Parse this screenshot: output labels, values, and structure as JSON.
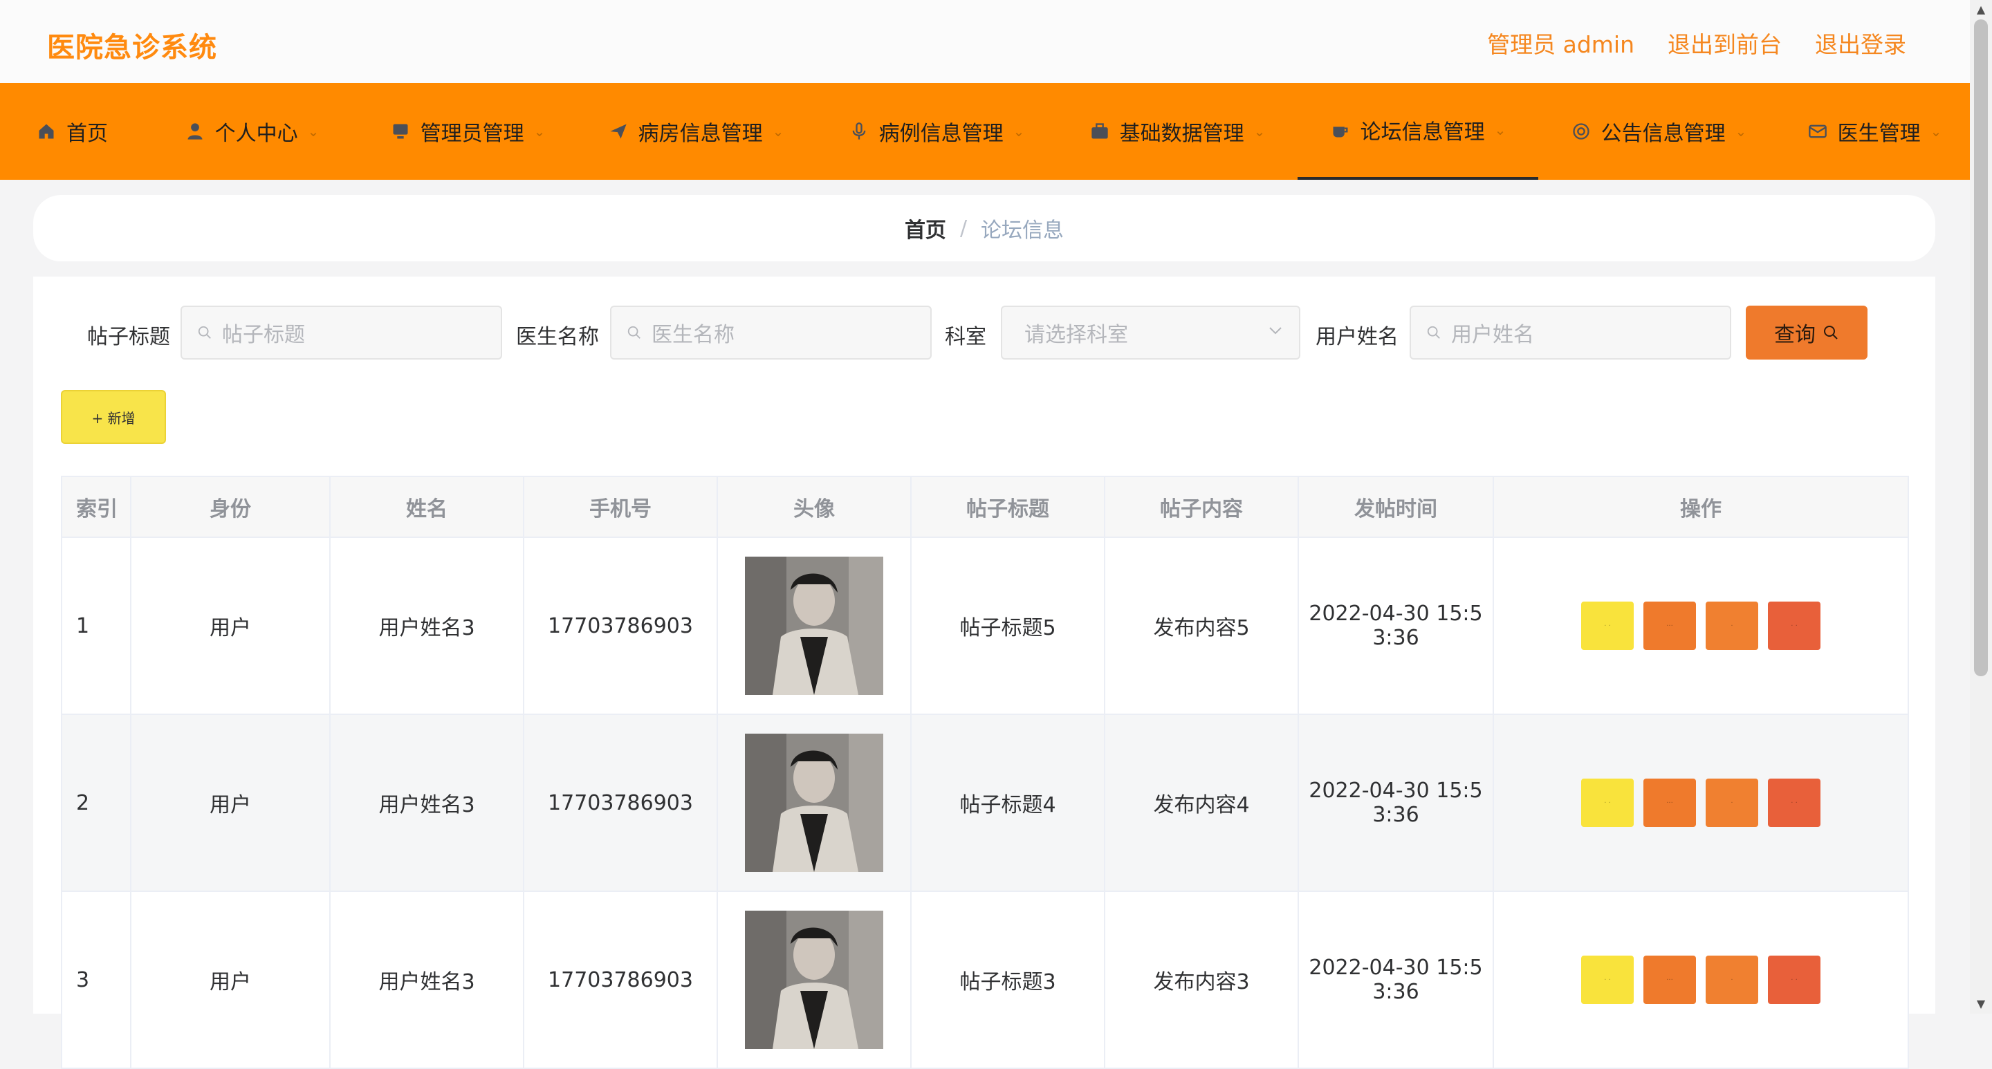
{
  "header": {
    "app_title": "医院急诊系统",
    "admin_label": "管理员 admin",
    "exit_front": "退出到前台",
    "logout": "退出登录"
  },
  "nav": {
    "items": [
      {
        "label": "首页",
        "icon": "home-icon",
        "dropdown": false
      },
      {
        "label": "个人中心",
        "icon": "user-icon",
        "dropdown": true
      },
      {
        "label": "管理员管理",
        "icon": "monitor-icon",
        "dropdown": true
      },
      {
        "label": "病房信息管理",
        "icon": "send-icon",
        "dropdown": true
      },
      {
        "label": "病例信息管理",
        "icon": "microphone-icon",
        "dropdown": true
      },
      {
        "label": "基础数据管理",
        "icon": "briefcase-icon",
        "dropdown": true
      },
      {
        "label": "论坛信息管理",
        "icon": "cup-icon",
        "dropdown": true,
        "active": true
      },
      {
        "label": "公告信息管理",
        "icon": "at-icon",
        "dropdown": true
      },
      {
        "label": "医生管理",
        "icon": "mail-icon",
        "dropdown": true
      }
    ]
  },
  "breadcrumb": {
    "home": "首页",
    "separator": "/",
    "current": "论坛信息"
  },
  "search": {
    "title_label": "帖子标题",
    "title_placeholder": "帖子标题",
    "doctor_label": "医生名称",
    "doctor_placeholder": "医生名称",
    "dept_label": "科室",
    "dept_placeholder": "请选择科室",
    "user_label": "用户姓名",
    "user_placeholder": "用户姓名",
    "query_button": "查询"
  },
  "add_button": "+ 新增",
  "table": {
    "headers": [
      "索引",
      "身份",
      "姓名",
      "手机号",
      "头像",
      "帖子标题",
      "帖子内容",
      "发帖时间",
      "操作"
    ],
    "rows": [
      {
        "index": "1",
        "role": "用户",
        "name": "用户姓名3",
        "phone": "17703786903",
        "title": "帖子标题5",
        "content": "发布内容5",
        "time_line1": "2022-04-30 15:5",
        "time_line2": "3:36"
      },
      {
        "index": "2",
        "role": "用户",
        "name": "用户姓名3",
        "phone": "17703786903",
        "title": "帖子标题4",
        "content": "发布内容4",
        "time_line1": "2022-04-30 15:5",
        "time_line2": "3:36"
      },
      {
        "index": "3",
        "role": "用户",
        "name": "用户姓名3",
        "phone": "17703786903",
        "title": "帖子标题3",
        "content": "发布内容3",
        "time_line1": "2022-04-30 15:5",
        "time_line2": "3:36"
      }
    ]
  },
  "colors": {
    "accent": "#ff8a00",
    "title": "#ff8a0f",
    "query": "#ef7a2c",
    "add": "#f8e44a",
    "danger": "#e8603a"
  }
}
